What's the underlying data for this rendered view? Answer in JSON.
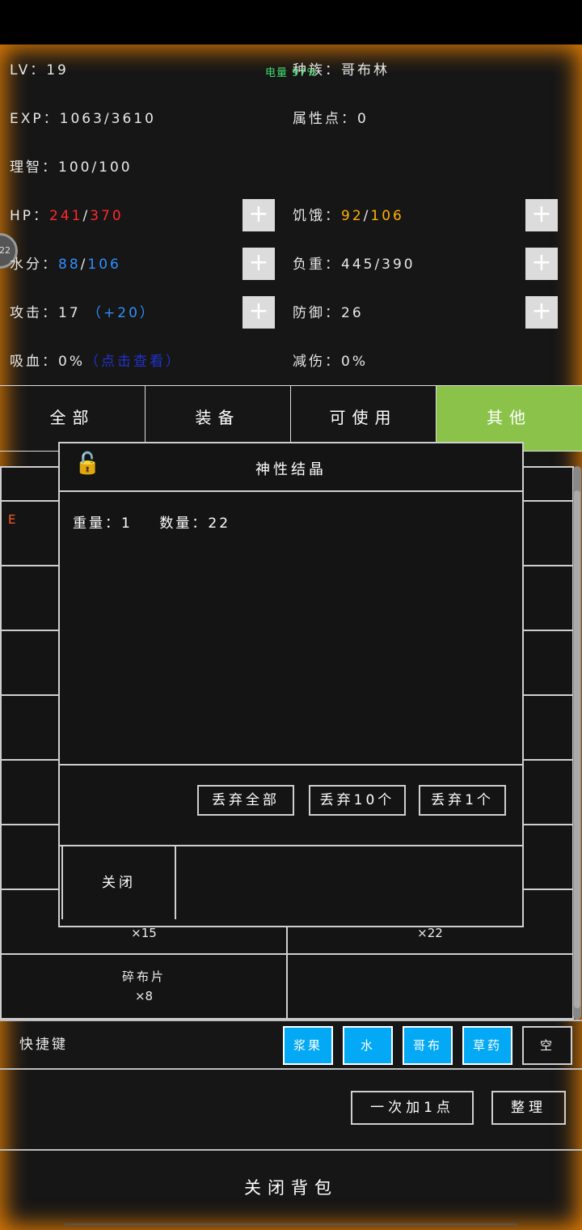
{
  "stats": {
    "lv": "LV：19",
    "race_label": "种族：",
    "race_value": "哥布林",
    "overlay_text": "电量 97%",
    "exp": "EXP：1063/3610",
    "attr_points": "属性点：0",
    "sanity": "理智：100/100",
    "hp_label": "HP：",
    "hp_cur": "241",
    "hp_max": "370",
    "hunger_label": "饥饿：",
    "hunger_cur": "92",
    "hunger_max": "106",
    "water_label": "水分：",
    "water_cur": "88",
    "water_max": "106",
    "weight": "负重：445/390",
    "attack": "攻击：17",
    "attack_bonus": "（+20）",
    "defense": "防御：26",
    "lifesteal": "吸血：0%",
    "lifesteal_hint": "（点击查看）",
    "damage_reduction": "减伤：0%",
    "side_badge": "22",
    "plus_glyph": "+"
  },
  "tabs": [
    {
      "label": "全部"
    },
    {
      "label": "装备"
    },
    {
      "label": "可使用"
    },
    {
      "label": "其他"
    }
  ],
  "inventory": {
    "partial_left_letter": "E",
    "visible_items": [
      {
        "count": "×15"
      },
      {
        "count": "×22"
      },
      {
        "name": "碎布片",
        "count": "×8"
      }
    ]
  },
  "dialog": {
    "lock_glyph": "🔓",
    "title": "神性结晶",
    "info": "重量：1    数量：22",
    "drop_all": "丢弃全部",
    "drop_10": "丢弃10个",
    "drop_1": "丢弃1个",
    "close": "关闭"
  },
  "shortcuts": {
    "label": "快捷键",
    "slots": [
      "浆果",
      "水",
      "哥布",
      "草药",
      "空"
    ]
  },
  "buttons": {
    "add_once": "一次加1点",
    "sort": "整理",
    "close_bag": "关闭背包"
  },
  "colors": {
    "tab_active": "#8bc34a",
    "shortcut": "#03a9f4",
    "glow": "#ff8c00",
    "hp": "#ff2a2a",
    "hunger": "#ffb000",
    "water": "#2f8fff"
  }
}
